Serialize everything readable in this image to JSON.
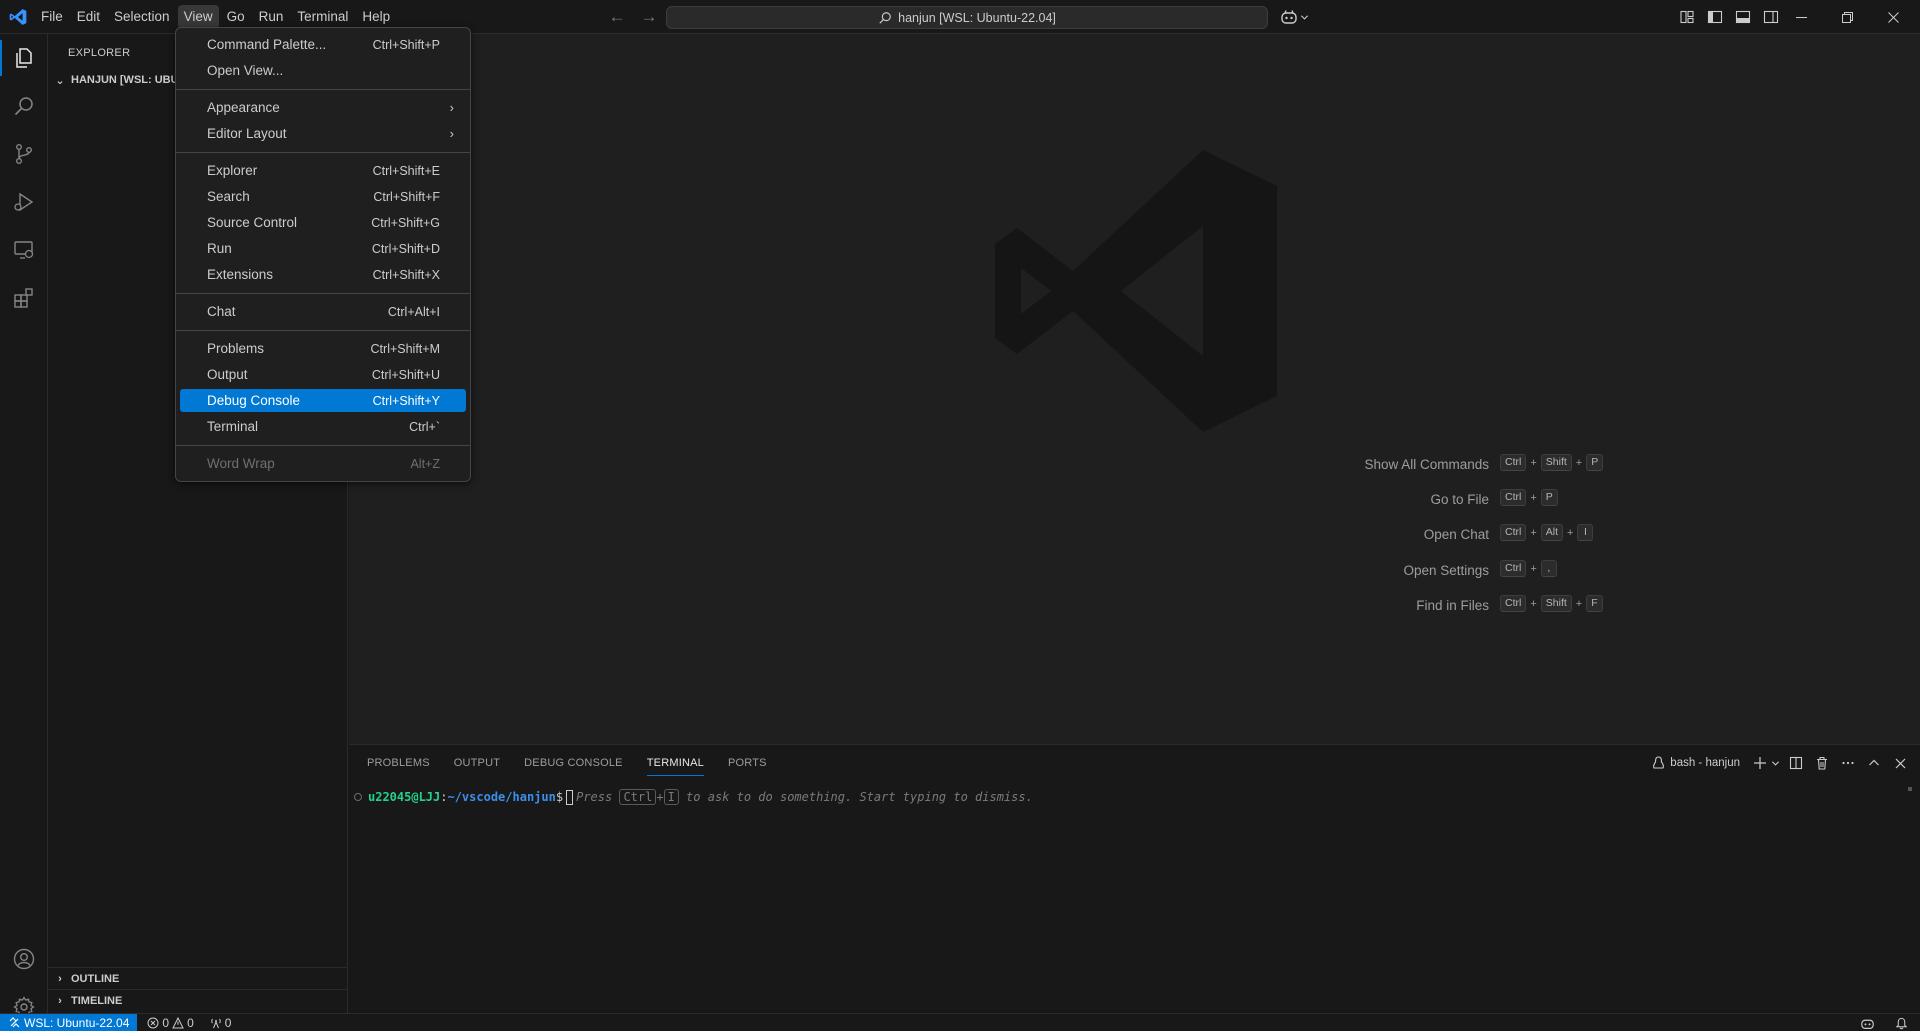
{
  "titlebar": {
    "menus": [
      "File",
      "Edit",
      "Selection",
      "View",
      "Go",
      "Run",
      "Terminal",
      "Help"
    ],
    "active_menu": "View",
    "command_center": "hanjun [WSL: Ubuntu-22.04]"
  },
  "sidebar": {
    "title": "EXPLORER",
    "workspace": "HANJUN [WSL: UBUNTU-22.04]",
    "sections": [
      "OUTLINE",
      "TIMELINE"
    ]
  },
  "view_menu": {
    "items": [
      {
        "label": "Command Palette...",
        "key": "Ctrl+Shift+P"
      },
      {
        "label": "Open View...",
        "key": ""
      },
      {
        "label": "Appearance",
        "key": "",
        "submenu": true
      },
      {
        "label": "Editor Layout",
        "key": "",
        "submenu": true
      },
      {
        "label": "Explorer",
        "key": "Ctrl+Shift+E"
      },
      {
        "label": "Search",
        "key": "Ctrl+Shift+F"
      },
      {
        "label": "Source Control",
        "key": "Ctrl+Shift+G"
      },
      {
        "label": "Run",
        "key": "Ctrl+Shift+D"
      },
      {
        "label": "Extensions",
        "key": "Ctrl+Shift+X"
      },
      {
        "label": "Chat",
        "key": "Ctrl+Alt+I"
      },
      {
        "label": "Problems",
        "key": "Ctrl+Shift+M"
      },
      {
        "label": "Output",
        "key": "Ctrl+Shift+U"
      },
      {
        "label": "Debug Console",
        "key": "Ctrl+Shift+Y",
        "selected": true
      },
      {
        "label": "Terminal",
        "key": "Ctrl+`"
      },
      {
        "label": "Word Wrap",
        "key": "Alt+Z",
        "disabled": true
      }
    ]
  },
  "editor": {
    "shortcuts": [
      {
        "label": "Show All Commands",
        "keys": [
          "Ctrl",
          "Shift",
          "P"
        ]
      },
      {
        "label": "Go to File",
        "keys": [
          "Ctrl",
          "P"
        ]
      },
      {
        "label": "Open Chat",
        "keys": [
          "Ctrl",
          "Alt",
          "I"
        ]
      },
      {
        "label": "Open Settings",
        "keys": [
          "Ctrl",
          ","
        ]
      },
      {
        "label": "Find in Files",
        "keys": [
          "Ctrl",
          "Shift",
          "F"
        ]
      }
    ],
    "plus": "+"
  },
  "panel": {
    "tabs": [
      "PROBLEMS",
      "OUTPUT",
      "DEBUG CONSOLE",
      "TERMINAL",
      "PORTS"
    ],
    "active_tab": "TERMINAL",
    "terminal_name": "bash - hanjun",
    "prompt_user": "u22045@LJJ",
    "prompt_colon": ":",
    "prompt_path": "~/vscode/hanjun",
    "prompt_dollar": "$",
    "hint_press": "Press ",
    "hint_key1": "Ctrl",
    "hint_plus": "+",
    "hint_key2": "I",
    "hint_rest": " to ask to do something. Start typing to dismiss."
  },
  "statusbar": {
    "remote": "WSL: Ubuntu-22.04",
    "errors": "0",
    "warnings": "0",
    "ports": "0"
  },
  "colors": {
    "accent": "#0078d4",
    "background": "#1f1f1f",
    "chrome": "#181818"
  }
}
